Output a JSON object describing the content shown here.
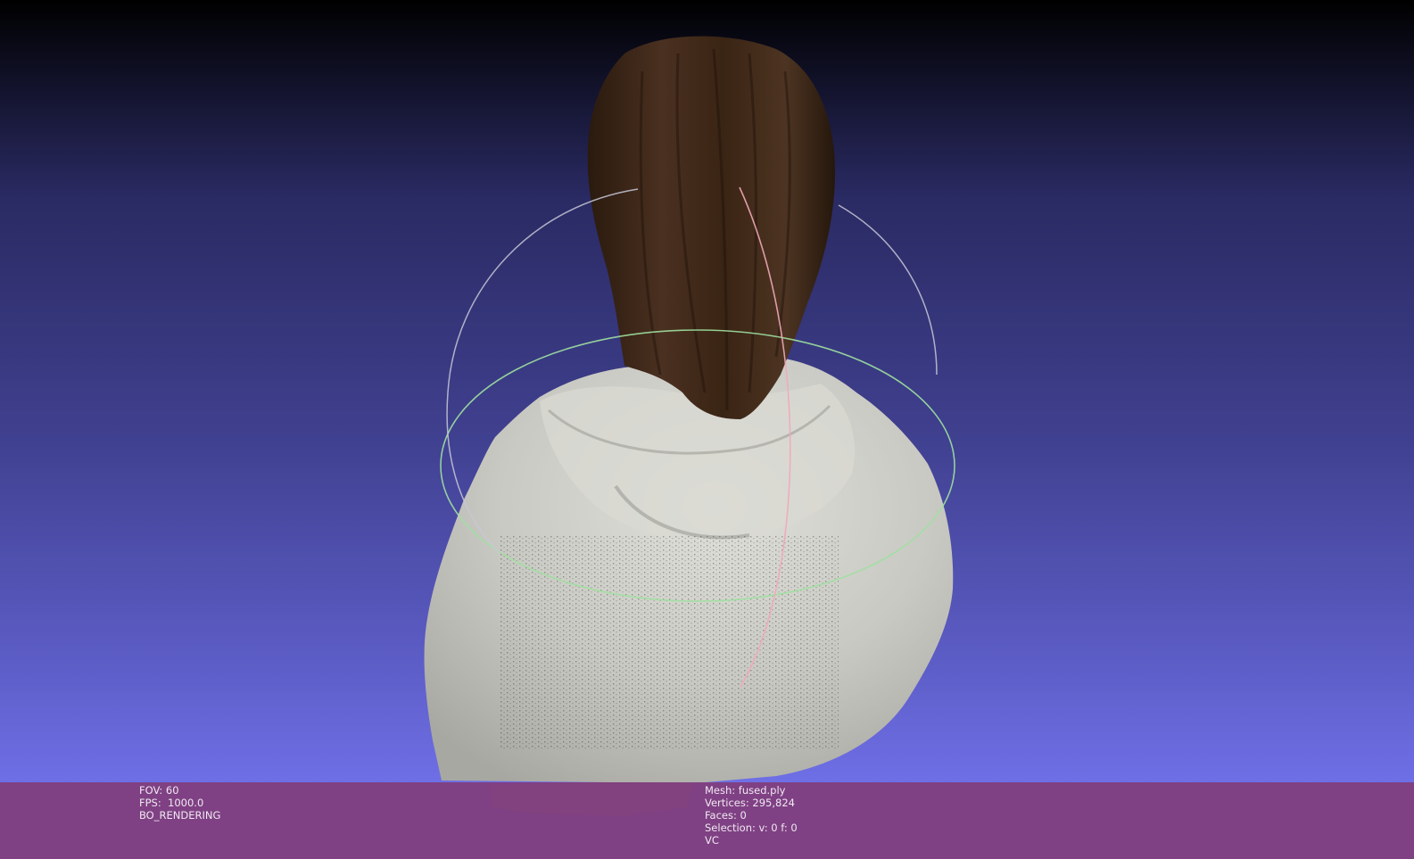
{
  "viewport": {
    "background_top": "#000000",
    "background_bottom": "#6f6fe6",
    "info_bar_color": "#804080",
    "left_info": {
      "fov": "FOV: 60",
      "fps": "FPS:  1000.0",
      "render_mode": "BO_RENDERING"
    },
    "right_info": {
      "mesh": "Mesh: fused.ply",
      "vertices": "Vertices: 295,824",
      "faces": "Faces: 0",
      "selection": "Selection: v: 0 f: 0",
      "color_mode": "VC"
    },
    "trackball": {
      "horizontal_ring_color": "#9fe0a0",
      "vertical_ring_color": "#f0a8b8",
      "side_ring_color": "#c8c8d8"
    },
    "mesh_colors": {
      "hair": "#3a2414",
      "hoodie": "#c9c9c3"
    }
  }
}
